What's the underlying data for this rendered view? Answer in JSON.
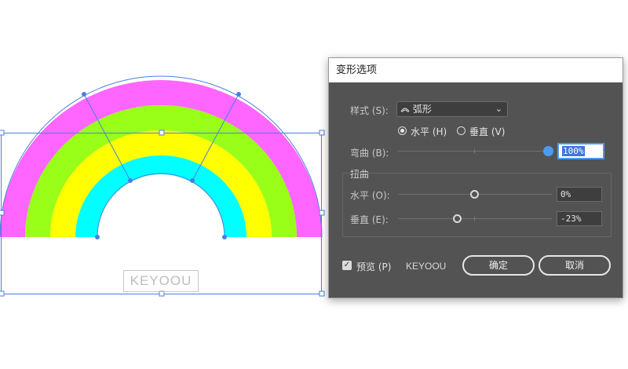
{
  "canvas": {
    "rainbow_colors": [
      "#ff66ff",
      "#99ff19",
      "#ffff00",
      "#00ffff"
    ],
    "selection_color": "#4a7fe0",
    "watermark": "KEYOOU"
  },
  "dialog": {
    "title": "变形选项",
    "style_label": "样式 (S):",
    "style_icon": "arc-style-icon",
    "style_value": "弧形",
    "orientation_horizontal": "水平 (H)",
    "orientation_vertical": "垂直 (V)",
    "orientation_selected": "horizontal",
    "bend_label": "弯曲 (B):",
    "bend_value": "100%",
    "bend_fraction": 1.0,
    "distortion_label": "扭曲",
    "horizontal_label": "水平 (O):",
    "horizontal_value": "0%",
    "horizontal_fraction": 0.5,
    "vertical_label": "垂直 (E):",
    "vertical_value": "-23%",
    "vertical_fraction": 0.385,
    "preview_label": "预览 (P)",
    "preview_checked": true,
    "watermark_text": "KEYOOU",
    "ok_label": "确定",
    "cancel_label": "取消",
    "accent_color": "#4b9bf0"
  }
}
